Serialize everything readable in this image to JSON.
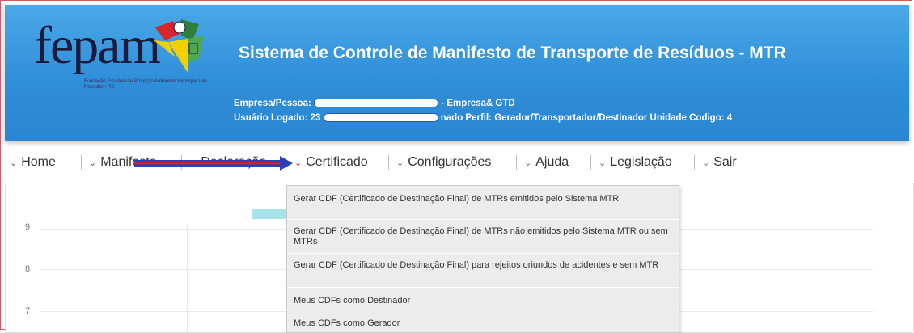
{
  "header": {
    "logo_text": "fepam",
    "logo_subtitle": "Fundação Estadual de Proteção Ambiental Henrique Luis Roessler - RS",
    "title": "Sistema de Controle de Manifesto de Transporte de Resíduos - MTR",
    "company_label": "Empresa/Pessoa:",
    "company_suffix": "- Empresa& GTD",
    "user_label": "Usuário Logado: 23",
    "user_suffix": "nado Perfil: Gerador/Transportador/Destinador Unidade Codigo: 4"
  },
  "nav": {
    "items": [
      {
        "label": "Home"
      },
      {
        "label": "Manifesto"
      },
      {
        "label": "Declaração"
      },
      {
        "label": "Certificado"
      },
      {
        "label": "Configurações"
      },
      {
        "label": "Ajuda"
      },
      {
        "label": "Legislação"
      },
      {
        "label": "Sair"
      }
    ]
  },
  "certificado_menu": {
    "items": [
      "Gerar CDF (Certificado de Destinação Final) de MTRs emitidos pelo Sistema MTR",
      "Gerar CDF (Certificado de Destinação Final) de MTRs não emitidos pelo Sistema MTR ou sem MTRs",
      "Gerar CDF (Certificado de Destinação Final) para rejeitos oriundos de acidentes e sem MTR",
      "Meus CDFs como Destinador",
      "Meus CDFs como Gerador"
    ]
  },
  "chart_data": {
    "type": "bar",
    "yticks": [
      "9",
      "8",
      "7"
    ],
    "legend_color": "#a9e3ea"
  },
  "colors": {
    "header_bg": "#2f8fd8",
    "arrow_red": "#d3202a",
    "arrow_blue": "#2b3fb8"
  },
  "icons": {
    "nav_chevron": "chevron-down-icon",
    "logo": "fepam-logo-icon"
  }
}
